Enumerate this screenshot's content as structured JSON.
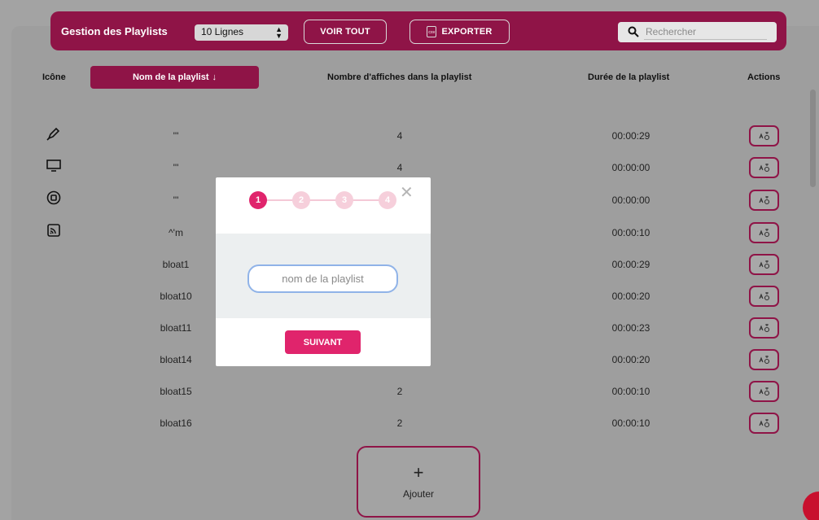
{
  "header": {
    "title": "Gestion des Playlists",
    "lines_select": "10 Lignes",
    "view_all_label": "VOIR TOUT",
    "export_label": "EXPORTER",
    "export_icon_text": "csv",
    "search_placeholder": "Rechercher"
  },
  "table": {
    "columns": {
      "icon": "Icône",
      "name": "Nom de la playlist",
      "sort_arrow": "↓",
      "count": "Nombre d'affiches dans la playlist",
      "duration": "Durée de la playlist",
      "actions": "Actions"
    },
    "rows": [
      {
        "icon": "pen-icon",
        "name": "'''",
        "count": "4",
        "duration": "00:00:29"
      },
      {
        "icon": "monitor-icon",
        "name": "'''",
        "count": "4",
        "duration": "00:00:00"
      },
      {
        "icon": "disc-icon",
        "name": "'''",
        "count": "",
        "duration": "00:00:00"
      },
      {
        "icon": "cast-icon",
        "name": "^'m",
        "count": "",
        "duration": "00:00:10"
      },
      {
        "icon": "",
        "name": "bloat1",
        "count": "",
        "duration": "00:00:29"
      },
      {
        "icon": "",
        "name": "bloat10",
        "count": "",
        "duration": "00:00:20"
      },
      {
        "icon": "",
        "name": "bloat11",
        "count": "",
        "duration": "00:00:23"
      },
      {
        "icon": "",
        "name": "bloat14",
        "count": "",
        "duration": "00:00:20"
      },
      {
        "icon": "",
        "name": "bloat15",
        "count": "2",
        "duration": "00:00:10"
      },
      {
        "icon": "",
        "name": "bloat16",
        "count": "2",
        "duration": "00:00:10"
      }
    ]
  },
  "add_button": {
    "plus": "+",
    "label": "Ajouter"
  },
  "modal": {
    "steps": [
      "1",
      "2",
      "3",
      "4"
    ],
    "active_step": 1,
    "close_symbol": "✕",
    "input_placeholder": "nom de la playlist",
    "next_label": "SUIVANT"
  },
  "colors": {
    "brand": "#8f1447",
    "accent": "#e0246c",
    "overlay": "#a3a3a3"
  }
}
